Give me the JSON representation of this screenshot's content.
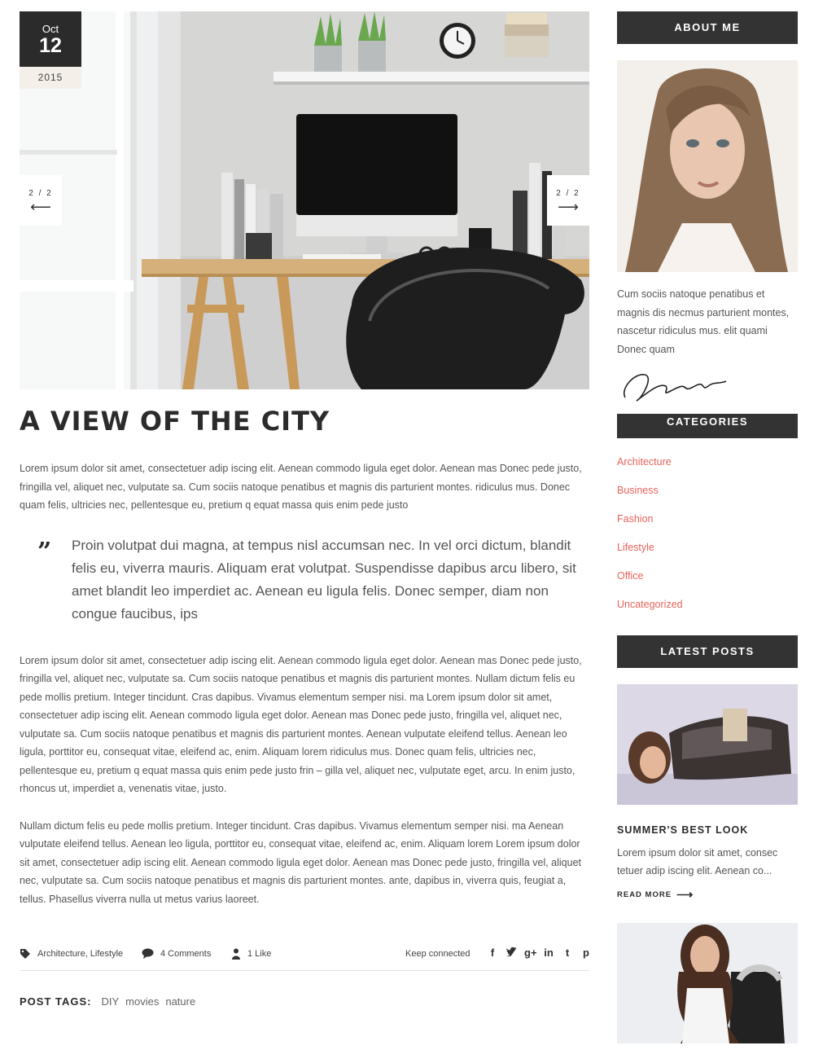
{
  "post": {
    "date": {
      "month": "Oct",
      "day": "12",
      "year": "2015"
    },
    "slider": {
      "counter": "2 / 2",
      "prev_arrow": "⟵",
      "next_arrow": "⟶"
    },
    "title": "A VIEW OF THE CITY",
    "paragraph1": "Lorem ipsum dolor sit amet, consectetuer adip iscing elit. Aenean commodo ligula eget dolor. Aenean mas Donec pede justo, fringilla vel, aliquet nec, vulputate sa. Cum sociis natoque penatibus et magnis dis parturient montes. ridiculus mus. Donec quam felis, ultricies nec, pellentesque eu, pretium q equat massa quis enim pede justo",
    "quote_mark": "”",
    "quote": "Proin volutpat dui magna, at tempus nisl accumsan nec. In vel orci dictum, blandit felis eu, viverra mauris. Aliquam erat volutpat. Suspendisse dapibus arcu libero, sit amet blandit leo imperdiet ac. Aenean eu ligula felis. Donec semper, diam non congue faucibus, ips",
    "paragraph2": "Lorem ipsum dolor sit amet, consectetuer adip iscing elit. Aenean commodo ligula eget dolor. Aenean mas Donec pede justo, fringilla vel, aliquet nec, vulputate sa. Cum sociis natoque penatibus et magnis dis parturient montes. Nullam dictum felis eu pede mollis pretium. Integer tincidunt. Cras dapibus. Vivamus elementum semper nisi. ma Lorem ipsum dolor sit amet, consectetuer adip iscing elit. Aenean commodo ligula eget dolor. Aenean mas Donec pede justo, fringilla vel, aliquet nec, vulputate sa. Cum sociis natoque penatibus et magnis dis parturient montes. Aenean vulputate eleifend tellus. Aenean leo ligula, porttitor eu, consequat vitae, eleifend ac, enim. Aliquam lorem ridiculus mus. Donec quam felis, ultricies nec, pellentesque eu, pretium q equat massa quis enim pede justo frin – gilla vel, aliquet nec, vulputate eget, arcu. In enim justo, rhoncus ut, imperdiet a, venenatis vitae, justo.",
    "paragraph3": "Nullam dictum felis eu pede mollis pretium. Integer tincidunt. Cras dapibus. Vivamus elementum semper nisi. ma Aenean vulputate eleifend tellus. Aenean leo ligula, porttitor eu, consequat vitae, eleifend ac, enim. Aliquam lorem Lorem ipsum dolor sit amet, consectetuer adip iscing elit. Aenean commodo ligula eget dolor. Aenean mas Donec pede justo, fringilla vel, aliquet nec, vulputate sa. Cum sociis natoque penatibus et magnis dis parturient montes. ante, dapibus in, viverra quis, feugiat a, tellus. Phasellus viverra nulla ut metus varius laoreet.",
    "meta": {
      "categories": "Architecture, Lifestyle",
      "comments": "4 Comments",
      "likes": "1 Like",
      "keep_connected": "Keep connected",
      "social_glyphs": {
        "facebook": "f",
        "twitter": "🐦",
        "google_plus": "g+",
        "linkedin": "in",
        "tumblr": "t",
        "pinterest": "p"
      }
    },
    "tags": {
      "label": "POST TAGS:",
      "items": [
        "DIY",
        "movies",
        "nature"
      ]
    }
  },
  "sidebar": {
    "about": {
      "title": "ABOUT ME",
      "text": "Cum sociis natoque penatibus et magnis dis necmus parturient montes, nascetur ridiculus mus. elit quami Donec quam"
    },
    "categories": {
      "title": "CATEGORIES",
      "items": [
        "Architecture",
        "Business",
        "Fashion",
        "Lifestyle",
        "Office",
        "Uncategorized"
      ]
    },
    "latest_posts": {
      "title": "LATEST POSTS",
      "post_title": "SUMMER'S BEST LOOK",
      "excerpt": "Lorem ipsum dolor sit amet, consec tetuer adip iscing elit. Aenean co...",
      "read_more": "READ MORE",
      "read_more_arrow": "⟶"
    }
  },
  "colors": {
    "accent": "#e8635a",
    "dark": "#333333",
    "badge_year_bg": "#f4efe9"
  },
  "icons": [
    "tag-icon",
    "comment-icon",
    "user-icon",
    "facebook-icon",
    "twitter-icon",
    "google-plus-icon",
    "linkedin-icon",
    "tumblr-icon",
    "pinterest-icon",
    "quote-icon",
    "arrow-left-icon",
    "arrow-right-icon"
  ]
}
